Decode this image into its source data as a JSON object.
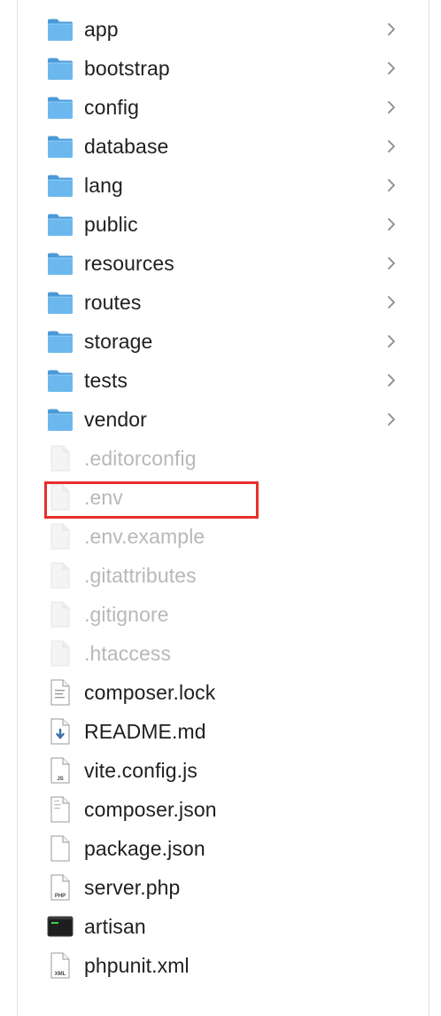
{
  "folders": [
    {
      "name": "app",
      "icon": "folder-icon"
    },
    {
      "name": "bootstrap",
      "icon": "folder-icon"
    },
    {
      "name": "config",
      "icon": "folder-icon"
    },
    {
      "name": "database",
      "icon": "folder-icon"
    },
    {
      "name": "lang",
      "icon": "folder-icon"
    },
    {
      "name": "public",
      "icon": "folder-icon"
    },
    {
      "name": "resources",
      "icon": "folder-icon"
    },
    {
      "name": "routes",
      "icon": "folder-icon"
    },
    {
      "name": "storage",
      "icon": "folder-icon"
    },
    {
      "name": "tests",
      "icon": "folder-icon"
    },
    {
      "name": "vendor",
      "icon": "folder-icon"
    }
  ],
  "files": [
    {
      "name": ".editorconfig",
      "icon": "blank-document-icon",
      "hidden": true
    },
    {
      "name": ".env",
      "icon": "blank-document-icon",
      "hidden": true,
      "highlighted": true
    },
    {
      "name": ".env.example",
      "icon": "blank-document-icon",
      "hidden": true
    },
    {
      "name": ".gitattributes",
      "icon": "blank-document-icon",
      "hidden": true
    },
    {
      "name": ".gitignore",
      "icon": "blank-document-icon",
      "hidden": true
    },
    {
      "name": ".htaccess",
      "icon": "blank-document-icon",
      "hidden": true
    },
    {
      "name": "composer.lock",
      "icon": "text-document-icon",
      "hidden": false
    },
    {
      "name": "README.md",
      "icon": "markdown-document-icon",
      "hidden": false
    },
    {
      "name": "vite.config.js",
      "icon": "js-document-icon",
      "hidden": false,
      "badge": "JS"
    },
    {
      "name": "composer.json",
      "icon": "json-document-icon",
      "hidden": false
    },
    {
      "name": "package.json",
      "icon": "blank-document-icon",
      "hidden": false
    },
    {
      "name": "server.php",
      "icon": "php-document-icon",
      "hidden": false,
      "badge": "PHP"
    },
    {
      "name": "artisan",
      "icon": "terminal-executable-icon",
      "hidden": false
    },
    {
      "name": "phpunit.xml",
      "icon": "xml-document-icon",
      "hidden": false,
      "badge": "XML"
    }
  ],
  "colors": {
    "folder_front": "#6cb8ee",
    "folder_back": "#4a9ad9",
    "highlight_border": "#e5302b",
    "hidden_text": "#b8b8b8",
    "text": "#1f1f1f"
  }
}
